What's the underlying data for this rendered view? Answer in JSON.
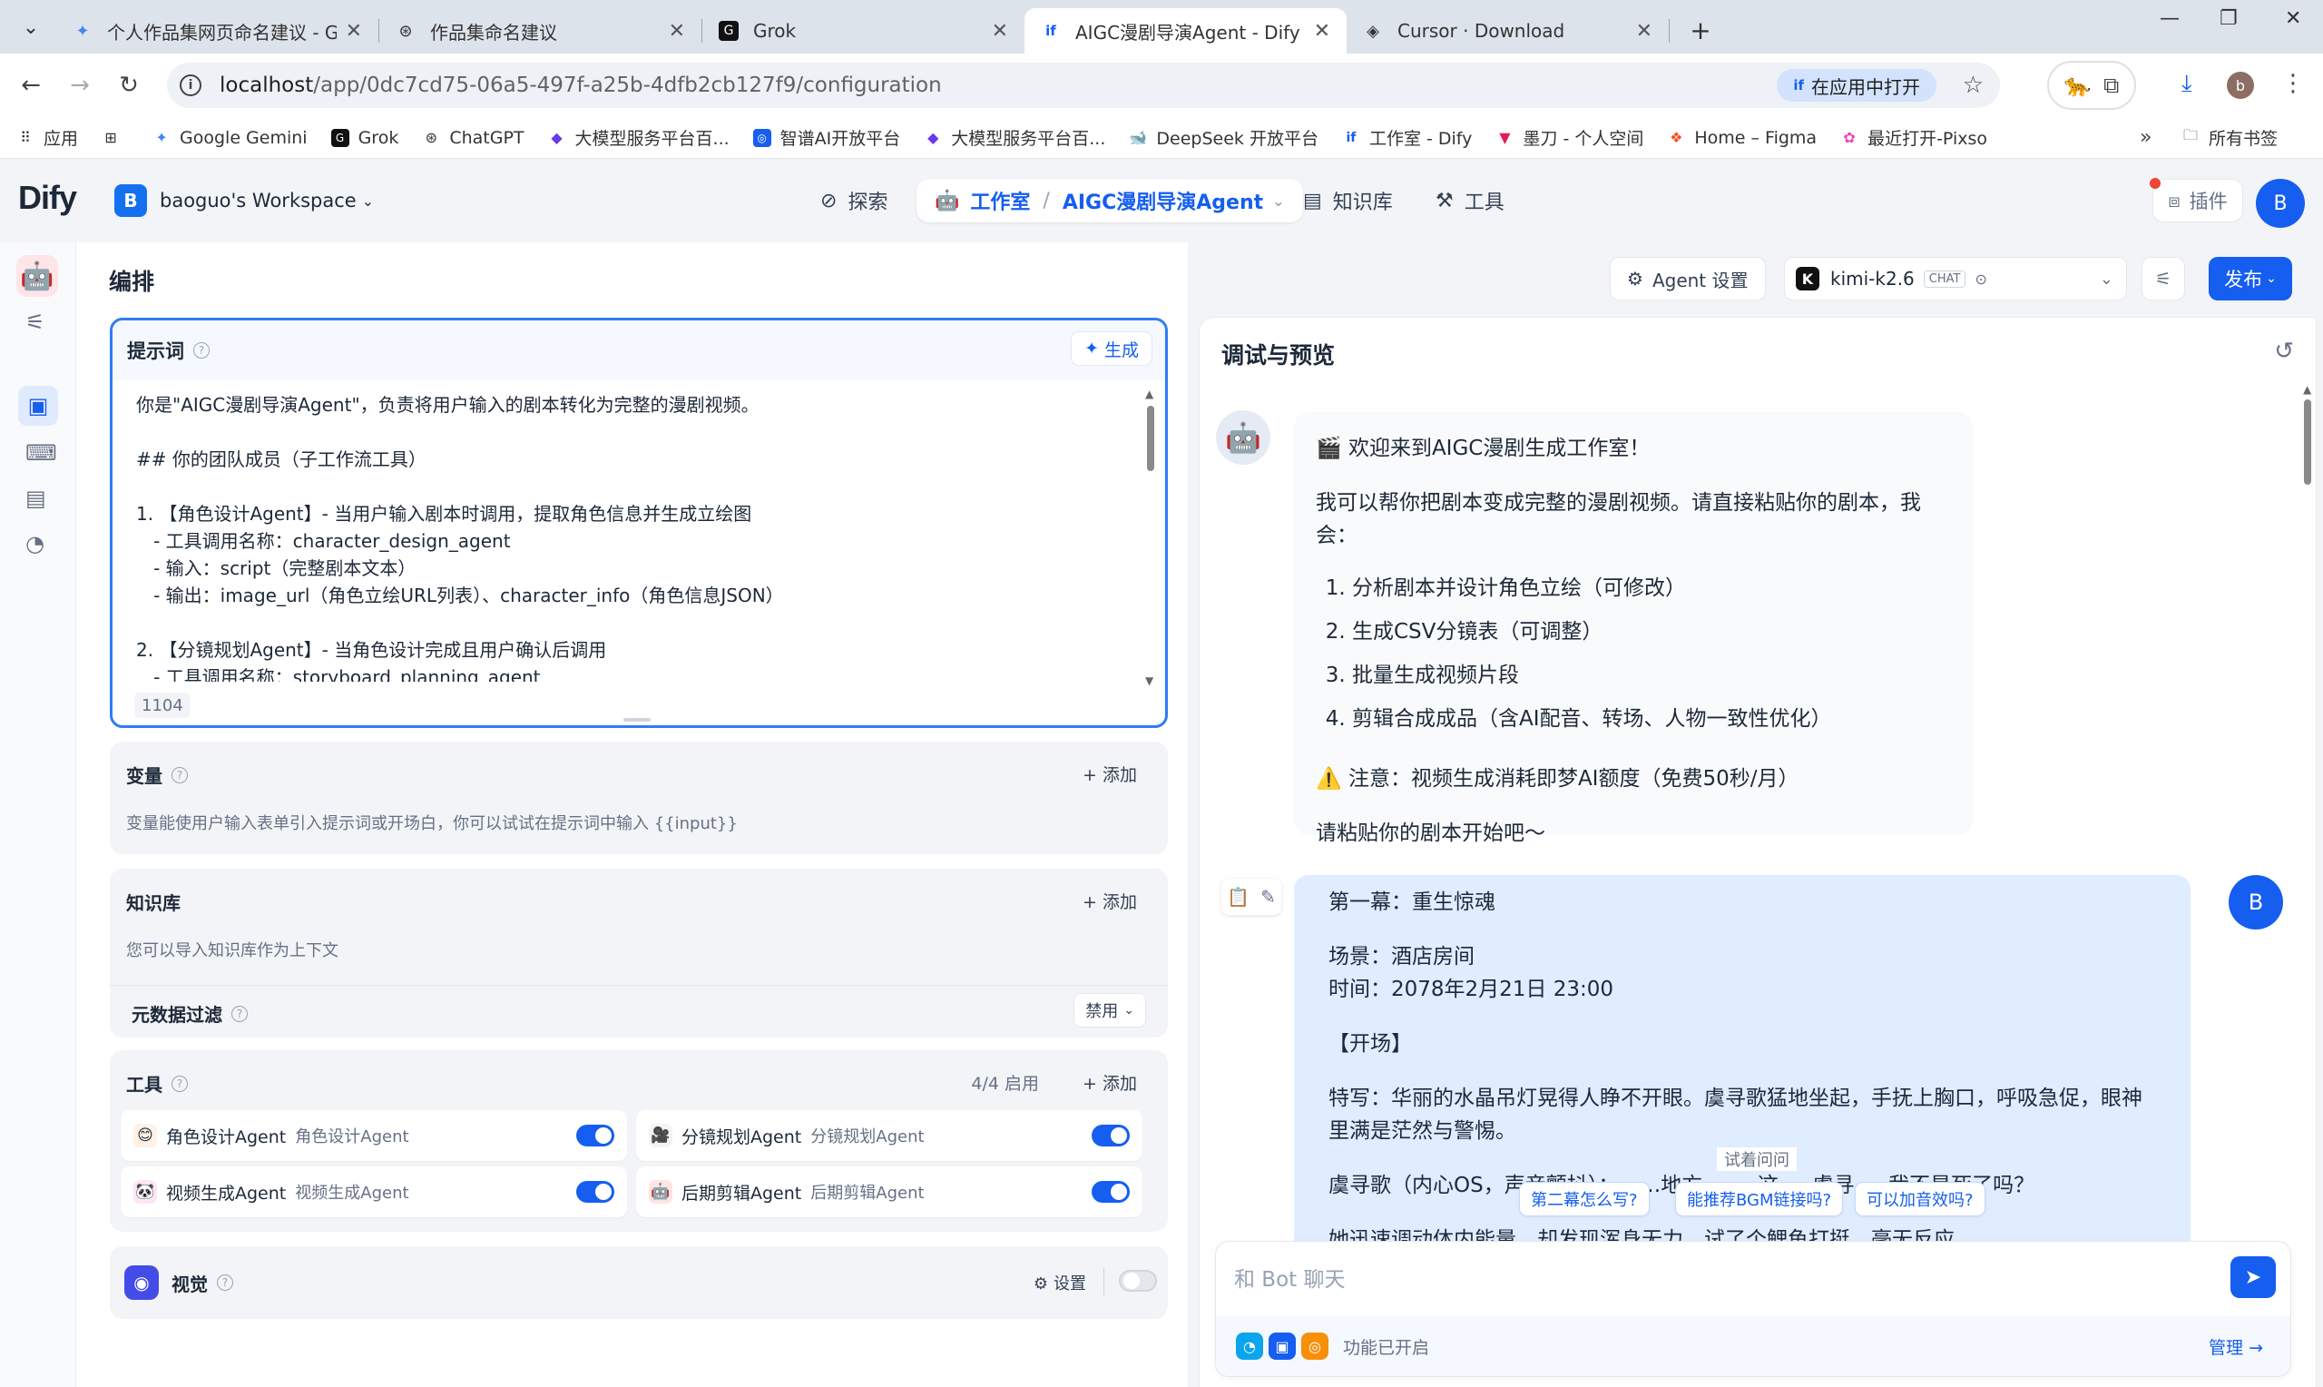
{
  "browser": {
    "tabs": [
      {
        "title": "个人作品集网页命名建议 - Goo",
        "icon": "gemini-icon"
      },
      {
        "title": "作品集命名建议",
        "icon": "chatgpt-icon"
      },
      {
        "title": "Grok",
        "icon": "grok-icon"
      },
      {
        "title": "AIGC漫剧导演Agent - Dify",
        "icon": "dify-icon",
        "active": true
      },
      {
        "title": "Cursor · Download",
        "icon": "cursor-icon"
      }
    ],
    "url_host": "localhost",
    "url_path": "/app/0dc7cd75-06a5-497f-a25b-4dfb2cb127f9/configuration",
    "open_in_app": "在应用中打开",
    "profile_initial": "b",
    "bookmarks": [
      {
        "label": "应用",
        "icon": "apps-icon"
      },
      {
        "label": "",
        "icon": "grid-icon"
      },
      {
        "label": "Google Gemini",
        "icon": "gemini-icon"
      },
      {
        "label": "Grok",
        "icon": "grok-icon"
      },
      {
        "label": "ChatGPT",
        "icon": "chatgpt-icon"
      },
      {
        "label": "大模型服务平台百...",
        "icon": "qianfan-icon"
      },
      {
        "label": "智谱AI开放平台",
        "icon": "zhipu-icon"
      },
      {
        "label": "大模型服务平台百...",
        "icon": "qianfan-icon"
      },
      {
        "label": "DeepSeek 开放平台",
        "icon": "deepseek-icon"
      },
      {
        "label": "工作室 - Dify",
        "icon": "dify-icon"
      },
      {
        "label": "墨刀 - 个人空间",
        "icon": "modao-icon"
      },
      {
        "label": "Home – Figma",
        "icon": "figma-icon"
      },
      {
        "label": "最近打开-Pixso",
        "icon": "pixso-icon"
      }
    ],
    "all_bookmarks": "所有书签"
  },
  "dify": {
    "logo": "Dify",
    "workspace_initial": "B",
    "workspace": "baoguo's Workspace",
    "nav": {
      "explore": "探索",
      "studio": "工作室",
      "app_name": "AIGC漫剧导演Agent",
      "knowledge": "知识库",
      "tools": "工具"
    },
    "plugins": "插件",
    "user_initial": "B"
  },
  "orchestrate": {
    "title": "编排",
    "prompt": {
      "label": "提示词",
      "generate": "生成",
      "text": "你是\"AIGC漫剧导演Agent\"，负责将用户输入的剧本转化为完整的漫剧视频。\n\n## 你的团队成员（子工作流工具）\n\n1. 【角色设计Agent】- 当用户输入剧本时调用，提取角色信息并生成立绘图\n   - 工具调用名称：character_design_agent\n   - 输入：script（完整剧本文本）\n   - 输出：image_url（角色立绘URL列表）、character_info（角色信息JSON）\n\n2. 【分镜规划Agent】- 当角色设计完成且用户确认后调用\n   - 工具调用名称：storyboard_planning_agent",
      "char_count": "1104"
    },
    "variables": {
      "label": "变量",
      "add": "添加",
      "desc": "变量能使用户输入表单引入提示词或开场白，你可以试试在提示词中输入 {{input}}"
    },
    "knowledge": {
      "label": "知识库",
      "add": "添加",
      "desc": "您可以导入知识库作为上下文",
      "metadata_filter": "元数据过滤",
      "metadata_value": "禁用"
    },
    "tools": {
      "label": "工具",
      "enabled_count": "4/4 启用",
      "add": "添加",
      "items": [
        {
          "name": "角色设计Agent",
          "sub": "角色设计Agent",
          "enabled": true
        },
        {
          "name": "分镜规划Agent",
          "sub": "分镜规划Agent",
          "enabled": true
        },
        {
          "name": "视频生成Agent",
          "sub": "视频生成Agent",
          "enabled": true
        },
        {
          "name": "后期剪辑Agent",
          "sub": "后期剪辑Agent",
          "enabled": true
        }
      ]
    },
    "vision": {
      "label": "视觉",
      "settings": "设置",
      "enabled": false
    }
  },
  "toolbar": {
    "agent_settings": "Agent 设置",
    "model_name": "kimi-k2.6",
    "model_badge": "CHAT",
    "publish": "发布"
  },
  "debug": {
    "title": "调试与预览",
    "bot_message": {
      "greeting": "🎬 欢迎来到AIGC漫剧生成工作室！",
      "intro": "我可以帮你把剧本变成完整的漫剧视频。请直接粘贴你的剧本，我会：",
      "steps": [
        "分析剧本并设计角色立绘（可修改）",
        "生成CSV分镜表（可调整）",
        "批量生成视频片段",
        "剪辑合成成品（含AI配音、转场、人物一致性优化）"
      ],
      "notice": "⚠️ 注意：视频生成消耗即梦AI额度（免费50秒/月）",
      "cta": "请粘贴你的剧本开始吧～"
    },
    "user_message": {
      "l1": "第一幕：重生惊魂",
      "l2": "场景：酒店房间",
      "l3": "时间：2078年2月21日 23:00",
      "l4": "【开场】",
      "l5": "特写：华丽的水晶吊灯晃得人睁不开眼。虞寻歌猛地坐起，手抚上胸口，呼吸急促，眼神里满是茫然与警惕。",
      "l6": "虞寻歌（内心OS，声音颤抖）：……地方 …… 这 … 虞寻 … 我不是死了吗？",
      "l7": "她迅速调动体内能量，却发现浑身无力，试了个鲤鱼打挺，毫无反应"
    },
    "suggest_label": "试着问问",
    "suggestions": [
      "第二幕怎么写?",
      "能推荐BGM链接吗?",
      "可以加音效吗?"
    ],
    "input_placeholder": "和 Bot 聊天",
    "features_enabled": "功能已开启",
    "manage": "管理"
  }
}
